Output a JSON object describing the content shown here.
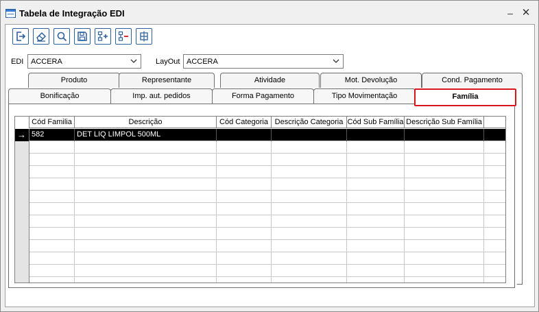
{
  "window": {
    "title": "Tabela de Integração EDI",
    "minimize_glyph": "–",
    "close_glyph": "✕"
  },
  "toolbar": {
    "buttons": [
      "exit-icon",
      "eraser-icon",
      "search-icon",
      "save-icon",
      "add-row-icon",
      "remove-row-icon",
      "grid-config-icon"
    ]
  },
  "filters": {
    "edi_label": "EDI",
    "edi_value": "ACCERA",
    "layout_label": "LayOut",
    "layout_value": "ACCERA"
  },
  "tabs": {
    "back_row": [
      "Produto",
      "Representante",
      "Atividade",
      "Mot. Devolução",
      "Cond. Pagamento"
    ],
    "front_row": [
      "Bonificação",
      "Imp. aut. pedidos",
      "Forma Pagamento",
      "Tipo Movimentação",
      "Família"
    ],
    "active": "Família"
  },
  "grid": {
    "columns": [
      "Cód Familia",
      "Descrição",
      "Cód Categoria",
      "Descrição Categoria",
      "Cód Sub Família",
      "Descrição Sub Família"
    ],
    "rows": [
      [
        "582",
        "DET LIQ LIMPOL 500ML",
        "",
        "",
        "",
        ""
      ]
    ],
    "selected_row_indicator": "→"
  },
  "colors": {
    "active_tab_border": "#d9141b",
    "toolbar_icon": "#2b5fa0",
    "selected_row_bg": "#000000"
  }
}
